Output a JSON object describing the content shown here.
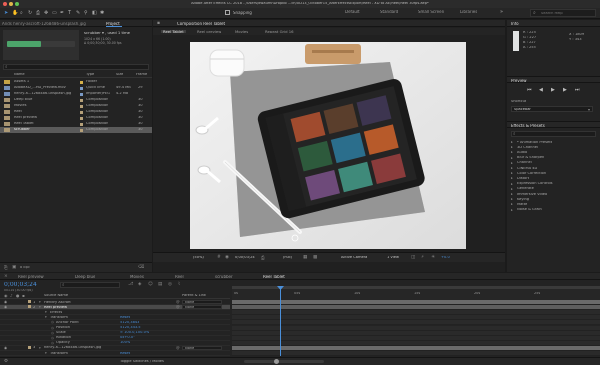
{
  "app": {
    "title": "Adobe After Effects CC 2018 - /Users/dwaumnDropbo ...ch/XD13_October15_AfterEffectsExport/Reel - XD to AE/Reel/Reel 30fps.aep*"
  },
  "toolbar": {
    "snapping_label": "Snapping",
    "workspaces": [
      "Default",
      "Standard",
      "Small Screen",
      "Libraries"
    ],
    "search_placeholder": "Search Help"
  },
  "project": {
    "tabs": [
      "Ands henry-ascroft-1268486-unsplash.jpg",
      "Project"
    ],
    "preview_name": "scrubber ▾ , used 1 time",
    "preview_meta": "1024 x 66 (1.00)\nΔ 0;00;30;00, 30.00 fps",
    "search_placeholder": "",
    "columns": [
      "Name",
      "Type",
      "Size",
      "Frame"
    ],
    "items": [
      {
        "name": "Assets 1",
        "type": "Folder",
        "size": "",
        "frame": "",
        "color": "#d6b14a",
        "selected": false
      },
      {
        "name": "AdobeXD_...HD_Preview.mov",
        "type": "QuickTime",
        "size": "49.4 MB",
        "frame": "29",
        "color": "#7b9ac6",
        "selected": false
      },
      {
        "name": "henry-a...1268486-unsplash.jpg",
        "type": "ImporterJPEG",
        "size": "4.2 MB",
        "frame": "",
        "color": "#7b9ac6",
        "selected": false
      },
      {
        "name": "Deep blue",
        "type": "Composition",
        "size": "",
        "frame": "30",
        "color": "#b6a17a",
        "selected": false
      },
      {
        "name": "Movies",
        "type": "Composition",
        "size": "",
        "frame": "30",
        "color": "#b6a17a",
        "selected": false
      },
      {
        "name": "Reel",
        "type": "Composition",
        "size": "",
        "frame": "30",
        "color": "#b6a17a",
        "selected": false
      },
      {
        "name": "Reel preview",
        "type": "Composition",
        "size": "",
        "frame": "30",
        "color": "#b6a17a",
        "selected": false
      },
      {
        "name": "Reel Tablet",
        "type": "Composition",
        "size": "",
        "frame": "30",
        "color": "#b6a17a",
        "selected": false
      },
      {
        "name": "scrubber",
        "type": "Composition",
        "size": "",
        "frame": "30",
        "color": "#b6a17a",
        "selected": true
      }
    ],
    "footer": "8 bpc"
  },
  "composition": {
    "header": "Composition Reel Tablet",
    "tabs": [
      "Reel Tablet",
      "Reel preview",
      "Movies",
      "Repeat Grid 16"
    ],
    "viewer_footer": {
      "zoom": "(50%)",
      "timecode": "0;00;03;24",
      "resolution": "(Full)",
      "camera": "Active Camera",
      "view": "1 View",
      "exposure": "+0.0"
    }
  },
  "info": {
    "title": "Info",
    "r": "R : 225",
    "g": "G : 227",
    "b": "B : 227",
    "a": "A : 255",
    "x": "X : 1809",
    "y": "Y : 343"
  },
  "preview": {
    "title": "Preview",
    "shortcut_label": "Shortcut",
    "shortcut_value": "Spacebar"
  },
  "effects": {
    "title": "Effects & Presets",
    "search_placeholder": "",
    "items": [
      "* Animation Presets",
      "3D Channel",
      "Audio",
      "Blur & Sharpen",
      "Channel",
      "CINEMA 4D",
      "Color Correction",
      "Distort",
      "Expression Controls",
      "Generate",
      "Immersive Video",
      "Keying",
      "Matte",
      "Noise & Grain"
    ]
  },
  "timeline": {
    "tabs": [
      "Reel preview",
      "Deep blue",
      "Movies",
      "Reel",
      "scrubber",
      "Reel Tablet"
    ],
    "timecode": "0;00;03;24",
    "frame_info": "00114 (30.00 fps)",
    "columns": {
      "name": "Source Name",
      "parent": "Parent & Link"
    },
    "rows": [
      {
        "num": "1",
        "name": "Hendry Ascroft",
        "parent": "None",
        "indent": 0,
        "kind": "layer"
      },
      {
        "num": "2",
        "name": "Reel preview",
        "parent": "None",
        "indent": 0,
        "kind": "layer",
        "selected": true
      },
      {
        "num": "",
        "name": "Effects",
        "parent": "",
        "indent": 1,
        "kind": "group"
      },
      {
        "num": "",
        "name": "Transform",
        "parent": "",
        "indent": 1,
        "kind": "group",
        "value": "Reset"
      },
      {
        "num": "",
        "name": "Anchor Point",
        "parent": "",
        "indent": 2,
        "kind": "prop",
        "value": "5120,3843"
      },
      {
        "num": "",
        "name": "Position",
        "parent": "",
        "indent": 2,
        "kind": "prop",
        "value": "5120,343.5"
      },
      {
        "num": "",
        "name": "Scale",
        "parent": "",
        "indent": 2,
        "kind": "prop",
        "value": "∞ 100.0,100.0%"
      },
      {
        "num": "",
        "name": "Rotation",
        "parent": "",
        "indent": 2,
        "kind": "prop",
        "value": "0x+0.0°"
      },
      {
        "num": "",
        "name": "Opacity",
        "parent": "",
        "indent": 2,
        "kind": "prop",
        "value": "100%"
      },
      {
        "num": "3",
        "name": "henry-a...1268486-unsplash.jpg",
        "parent": "None",
        "indent": 0,
        "kind": "layer"
      },
      {
        "num": "",
        "name": "Transform",
        "parent": "",
        "indent": 1,
        "kind": "group",
        "value": "Reset"
      }
    ],
    "ruler": [
      "0s",
      "05s",
      "10s",
      "15s",
      "20s",
      "25s"
    ],
    "footer": "Toggle Switches / Modes"
  }
}
